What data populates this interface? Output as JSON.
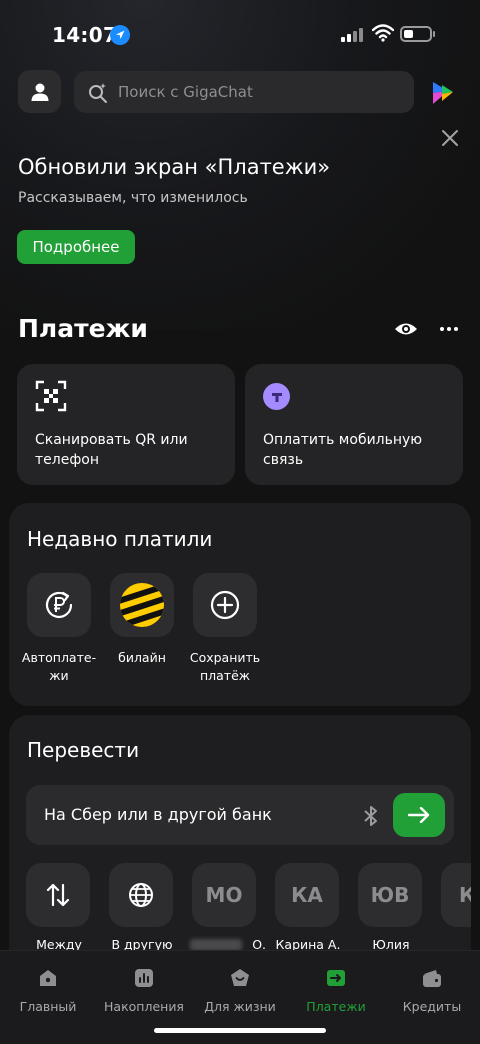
{
  "status_bar": {
    "time": "14:07"
  },
  "header": {
    "search_placeholder": "Поиск с GigaChat"
  },
  "banner": {
    "title": "Обновили экран «Платежи»",
    "subtitle": "Рассказываем, что изменилось",
    "button_label": "Подробнее"
  },
  "payments": {
    "title": "Платежи",
    "quick_actions": [
      {
        "label": "Сканировать QR или телефон",
        "icon": "qr-scan-icon"
      },
      {
        "label": "Оплатить мобильную связь",
        "icon": "mobile-operator-icon"
      }
    ]
  },
  "recent": {
    "title": "Недавно платили",
    "items": [
      {
        "label": "Автоплате-жи",
        "icon": "autopay-ruble-icon"
      },
      {
        "label": "билайн",
        "icon": "beeline-logo-icon"
      },
      {
        "label": "Сохранить платёж",
        "icon": "plus-circle-icon"
      }
    ]
  },
  "transfer": {
    "title": "Перевести",
    "field_label": "На Сбер или в другой банк",
    "contacts": [
      {
        "initials": "",
        "label": "Между",
        "icon": "arrows-swap-icon"
      },
      {
        "initials": "",
        "label": "В другую",
        "icon": "globe-icon"
      },
      {
        "initials": "МО",
        "label": "О."
      },
      {
        "initials": "КА",
        "label": "Карина А."
      },
      {
        "initials": "ЮВ",
        "label": "Юлия"
      },
      {
        "initials": "К",
        "label": "Ка"
      }
    ]
  },
  "tabbar": {
    "active": "Платежи",
    "tabs": [
      {
        "label": "Главный",
        "icon": "home-icon"
      },
      {
        "label": "Накопления",
        "icon": "chart-icon"
      },
      {
        "label": "Для жизни",
        "icon": "lifestyle-icon"
      },
      {
        "label": "Платежи",
        "icon": "payments-icon"
      },
      {
        "label": "Кредиты",
        "icon": "wallet-icon"
      }
    ]
  },
  "colors": {
    "accent": "#21a038",
    "background": "#121212",
    "card": "#242426"
  }
}
